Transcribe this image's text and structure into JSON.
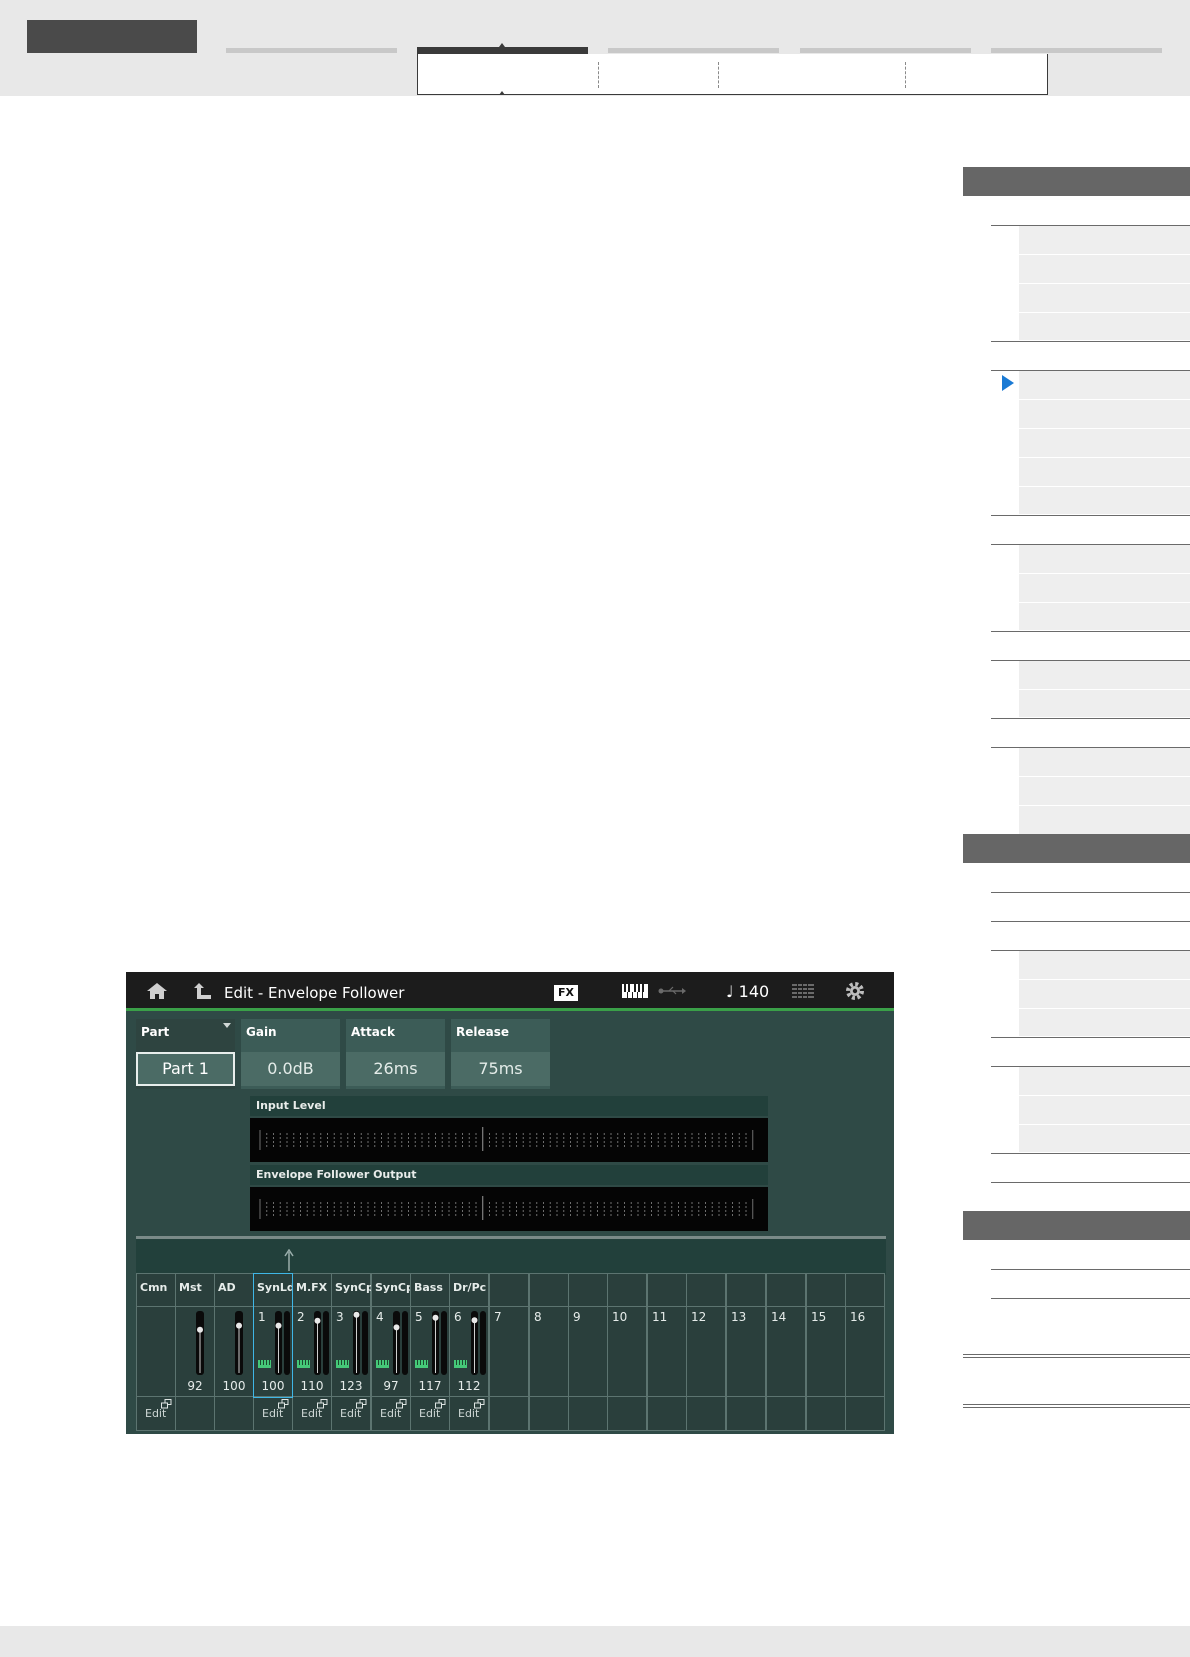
{
  "screen": {
    "title": "Edit - Envelope Follower",
    "fx_badge": "FX",
    "tempo": "♩ 140",
    "params": [
      {
        "label": "Part",
        "value": "Part 1"
      },
      {
        "label": "Gain",
        "value": "0.0dB"
      },
      {
        "label": "Attack",
        "value": "26ms"
      },
      {
        "label": "Release",
        "value": "75ms"
      }
    ],
    "meters": {
      "input_label": "Input Level",
      "output_label": "Envelope Follower Output"
    },
    "mixer": {
      "top_labels": [
        "Cmn",
        "Mst",
        "AD",
        "SynLd",
        "M.FX",
        "SynCp",
        "SynCp",
        "Bass",
        "Dr/Pc"
      ],
      "part_numbers": [
        "1",
        "2",
        "3",
        "4",
        "5",
        "6",
        "7",
        "8",
        "9",
        "10",
        "11",
        "12",
        "13",
        "14",
        "15",
        "16"
      ],
      "master_volume": "92",
      "ad_volume": "100",
      "part_volumes": [
        "100",
        "110",
        "123",
        "97",
        "117",
        "112"
      ],
      "edit_label": "Edit",
      "master_level": 0.72,
      "ad_level": 0.79,
      "part_levels": [
        0.79,
        0.87,
        0.97,
        0.76,
        0.92,
        0.88
      ]
    }
  },
  "colors": {
    "screen_bg": "#2f4a46",
    "title_bar": "#1c1c1c",
    "accent_green": "#3aa048",
    "selection_blue": "#3fb6e6",
    "index_marker": "#1a7ad4"
  },
  "icons": [
    "home-icon",
    "back-icon",
    "keyboard-icon",
    "usb-icon",
    "grid-icon",
    "gear-icon",
    "keyboard-indicator-icon",
    "edit-window-icon",
    "up-arrow-icon",
    "play-marker-icon"
  ]
}
